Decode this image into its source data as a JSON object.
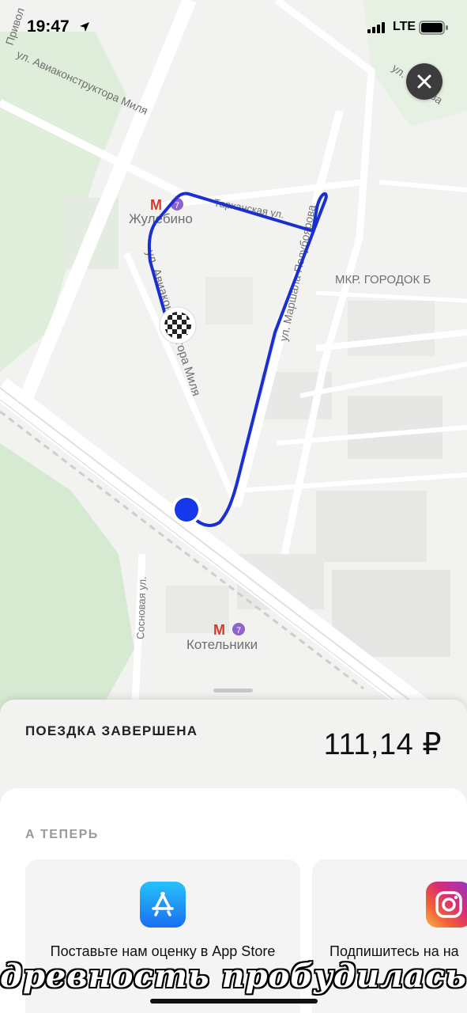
{
  "status_bar": {
    "time": "19:47",
    "network": "LTE"
  },
  "map": {
    "labels": {
      "street_privolnaya": "Привол",
      "street_aviakonstruktora": "ул. Авиаконструктора Миля",
      "street_aviakonstruktora_2": "ул. Авиаконструктора Миля",
      "metro_zhulebino": "Жулебино",
      "metro_kotelniki": "Котельники",
      "street_traktornaya": "Тарханская ул.",
      "street_marshala": "ул. Маршала Полубоярова",
      "district": "МКР. ГОРОДОК Б",
      "street_sosnovaya": "Сосновая ул.",
      "street_top_right": "ул. Егорова",
      "metro_line_number": "7"
    }
  },
  "trip": {
    "status": "ПОЕЗДКА ЗАВЕРШЕНА",
    "price": "111,14 ₽"
  },
  "next": {
    "title": "А ТЕПЕРЬ",
    "cards": [
      {
        "text": "Поставьте нам оценку в App Store",
        "icon": "app-store-icon"
      },
      {
        "text": "Подпишитесь на на",
        "icon": "instagram-icon"
      }
    ]
  },
  "caption": "древность пробудилась"
}
